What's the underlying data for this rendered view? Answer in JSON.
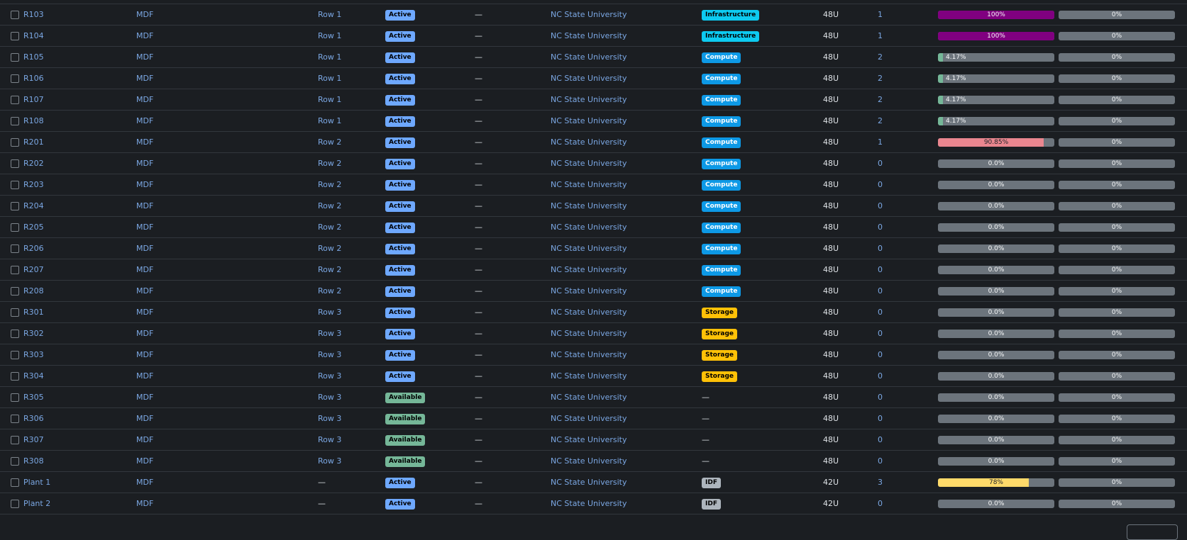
{
  "colors": {
    "active": "#6ea8fe",
    "available": "#75b798",
    "infrastructure": "#0dcaf0",
    "compute": "#0d99e6",
    "storage": "#ffc107",
    "idf": "#adb5bd",
    "util_purple": "#800080",
    "util_green": "#75b798",
    "util_red": "#ea868f",
    "util_yellow": "#ffda6a"
  },
  "racks": [
    {
      "name": "R103",
      "site": "MDF",
      "row": "Row 1",
      "status": "Active",
      "status_kind": "active",
      "tenant_group": "—",
      "tenant": "NC State University",
      "role": "Infrastructure",
      "role_kind": "infrastructure",
      "height": "48U",
      "devices": "1",
      "space": {
        "label": "100%",
        "fraction": 1.0,
        "color": "util_purple"
      },
      "power": "0%"
    },
    {
      "name": "R104",
      "site": "MDF",
      "row": "Row 1",
      "status": "Active",
      "status_kind": "active",
      "tenant_group": "—",
      "tenant": "NC State University",
      "role": "Infrastructure",
      "role_kind": "infrastructure",
      "height": "48U",
      "devices": "1",
      "space": {
        "label": "100%",
        "fraction": 1.0,
        "color": "util_purple"
      },
      "power": "0%"
    },
    {
      "name": "R105",
      "site": "MDF",
      "row": "Row 1",
      "status": "Active",
      "status_kind": "active",
      "tenant_group": "—",
      "tenant": "NC State University",
      "role": "Compute",
      "role_kind": "compute",
      "height": "48U",
      "devices": "2",
      "space": {
        "label": "4.17%",
        "fraction": 0.0417,
        "color": "util_green"
      },
      "power": "0%"
    },
    {
      "name": "R106",
      "site": "MDF",
      "row": "Row 1",
      "status": "Active",
      "status_kind": "active",
      "tenant_group": "—",
      "tenant": "NC State University",
      "role": "Compute",
      "role_kind": "compute",
      "height": "48U",
      "devices": "2",
      "space": {
        "label": "4.17%",
        "fraction": 0.0417,
        "color": "util_green"
      },
      "power": "0%"
    },
    {
      "name": "R107",
      "site": "MDF",
      "row": "Row 1",
      "status": "Active",
      "status_kind": "active",
      "tenant_group": "—",
      "tenant": "NC State University",
      "role": "Compute",
      "role_kind": "compute",
      "height": "48U",
      "devices": "2",
      "space": {
        "label": "4.17%",
        "fraction": 0.0417,
        "color": "util_green"
      },
      "power": "0%"
    },
    {
      "name": "R108",
      "site": "MDF",
      "row": "Row 1",
      "status": "Active",
      "status_kind": "active",
      "tenant_group": "—",
      "tenant": "NC State University",
      "role": "Compute",
      "role_kind": "compute",
      "height": "48U",
      "devices": "2",
      "space": {
        "label": "4.17%",
        "fraction": 0.0417,
        "color": "util_green"
      },
      "power": "0%"
    },
    {
      "name": "R201",
      "site": "MDF",
      "row": "Row 2",
      "status": "Active",
      "status_kind": "active",
      "tenant_group": "—",
      "tenant": "NC State University",
      "role": "Compute",
      "role_kind": "compute",
      "height": "48U",
      "devices": "1",
      "space": {
        "label": "90.85%",
        "fraction": 0.9085,
        "color": "util_red"
      },
      "power": "0%"
    },
    {
      "name": "R202",
      "site": "MDF",
      "row": "Row 2",
      "status": "Active",
      "status_kind": "active",
      "tenant_group": "—",
      "tenant": "NC State University",
      "role": "Compute",
      "role_kind": "compute",
      "height": "48U",
      "devices": "0",
      "space": {
        "label": "0.0%",
        "fraction": 0,
        "color": "util_green"
      },
      "power": "0%"
    },
    {
      "name": "R203",
      "site": "MDF",
      "row": "Row 2",
      "status": "Active",
      "status_kind": "active",
      "tenant_group": "—",
      "tenant": "NC State University",
      "role": "Compute",
      "role_kind": "compute",
      "height": "48U",
      "devices": "0",
      "space": {
        "label": "0.0%",
        "fraction": 0,
        "color": "util_green"
      },
      "power": "0%"
    },
    {
      "name": "R204",
      "site": "MDF",
      "row": "Row 2",
      "status": "Active",
      "status_kind": "active",
      "tenant_group": "—",
      "tenant": "NC State University",
      "role": "Compute",
      "role_kind": "compute",
      "height": "48U",
      "devices": "0",
      "space": {
        "label": "0.0%",
        "fraction": 0,
        "color": "util_green"
      },
      "power": "0%"
    },
    {
      "name": "R205",
      "site": "MDF",
      "row": "Row 2",
      "status": "Active",
      "status_kind": "active",
      "tenant_group": "—",
      "tenant": "NC State University",
      "role": "Compute",
      "role_kind": "compute",
      "height": "48U",
      "devices": "0",
      "space": {
        "label": "0.0%",
        "fraction": 0,
        "color": "util_green"
      },
      "power": "0%"
    },
    {
      "name": "R206",
      "site": "MDF",
      "row": "Row 2",
      "status": "Active",
      "status_kind": "active",
      "tenant_group": "—",
      "tenant": "NC State University",
      "role": "Compute",
      "role_kind": "compute",
      "height": "48U",
      "devices": "0",
      "space": {
        "label": "0.0%",
        "fraction": 0,
        "color": "util_green"
      },
      "power": "0%"
    },
    {
      "name": "R207",
      "site": "MDF",
      "row": "Row 2",
      "status": "Active",
      "status_kind": "active",
      "tenant_group": "—",
      "tenant": "NC State University",
      "role": "Compute",
      "role_kind": "compute",
      "height": "48U",
      "devices": "0",
      "space": {
        "label": "0.0%",
        "fraction": 0,
        "color": "util_green"
      },
      "power": "0%"
    },
    {
      "name": "R208",
      "site": "MDF",
      "row": "Row 2",
      "status": "Active",
      "status_kind": "active",
      "tenant_group": "—",
      "tenant": "NC State University",
      "role": "Compute",
      "role_kind": "compute",
      "height": "48U",
      "devices": "0",
      "space": {
        "label": "0.0%",
        "fraction": 0,
        "color": "util_green"
      },
      "power": "0%"
    },
    {
      "name": "R301",
      "site": "MDF",
      "row": "Row 3",
      "status": "Active",
      "status_kind": "active",
      "tenant_group": "—",
      "tenant": "NC State University",
      "role": "Storage",
      "role_kind": "storage",
      "height": "48U",
      "devices": "0",
      "space": {
        "label": "0.0%",
        "fraction": 0,
        "color": "util_green"
      },
      "power": "0%"
    },
    {
      "name": "R302",
      "site": "MDF",
      "row": "Row 3",
      "status": "Active",
      "status_kind": "active",
      "tenant_group": "—",
      "tenant": "NC State University",
      "role": "Storage",
      "role_kind": "storage",
      "height": "48U",
      "devices": "0",
      "space": {
        "label": "0.0%",
        "fraction": 0,
        "color": "util_green"
      },
      "power": "0%"
    },
    {
      "name": "R303",
      "site": "MDF",
      "row": "Row 3",
      "status": "Active",
      "status_kind": "active",
      "tenant_group": "—",
      "tenant": "NC State University",
      "role": "Storage",
      "role_kind": "storage",
      "height": "48U",
      "devices": "0",
      "space": {
        "label": "0.0%",
        "fraction": 0,
        "color": "util_green"
      },
      "power": "0%"
    },
    {
      "name": "R304",
      "site": "MDF",
      "row": "Row 3",
      "status": "Active",
      "status_kind": "active",
      "tenant_group": "—",
      "tenant": "NC State University",
      "role": "Storage",
      "role_kind": "storage",
      "height": "48U",
      "devices": "0",
      "space": {
        "label": "0.0%",
        "fraction": 0,
        "color": "util_green"
      },
      "power": "0%"
    },
    {
      "name": "R305",
      "site": "MDF",
      "row": "Row 3",
      "status": "Available",
      "status_kind": "available",
      "tenant_group": "—",
      "tenant": "NC State University",
      "role": "—",
      "role_kind": "none",
      "height": "48U",
      "devices": "0",
      "space": {
        "label": "0.0%",
        "fraction": 0,
        "color": "util_green"
      },
      "power": "0%"
    },
    {
      "name": "R306",
      "site": "MDF",
      "row": "Row 3",
      "status": "Available",
      "status_kind": "available",
      "tenant_group": "—",
      "tenant": "NC State University",
      "role": "—",
      "role_kind": "none",
      "height": "48U",
      "devices": "0",
      "space": {
        "label": "0.0%",
        "fraction": 0,
        "color": "util_green"
      },
      "power": "0%"
    },
    {
      "name": "R307",
      "site": "MDF",
      "row": "Row 3",
      "status": "Available",
      "status_kind": "available",
      "tenant_group": "—",
      "tenant": "NC State University",
      "role": "—",
      "role_kind": "none",
      "height": "48U",
      "devices": "0",
      "space": {
        "label": "0.0%",
        "fraction": 0,
        "color": "util_green"
      },
      "power": "0%"
    },
    {
      "name": "R308",
      "site": "MDF",
      "row": "Row 3",
      "status": "Available",
      "status_kind": "available",
      "tenant_group": "—",
      "tenant": "NC State University",
      "role": "—",
      "role_kind": "none",
      "height": "48U",
      "devices": "0",
      "space": {
        "label": "0.0%",
        "fraction": 0,
        "color": "util_green"
      },
      "power": "0%"
    },
    {
      "name": "Plant 1",
      "site": "MDF",
      "row": "—",
      "status": "Active",
      "status_kind": "active",
      "tenant_group": "—",
      "tenant": "NC State University",
      "role": "IDF",
      "role_kind": "idf",
      "height": "42U",
      "devices": "3",
      "space": {
        "label": "78%",
        "fraction": 0.78,
        "color": "util_yellow"
      },
      "power": "0%"
    },
    {
      "name": "Plant 2",
      "site": "MDF",
      "row": "—",
      "status": "Active",
      "status_kind": "active",
      "tenant_group": "—",
      "tenant": "NC State University",
      "role": "IDF",
      "role_kind": "idf",
      "height": "42U",
      "devices": "0",
      "space": {
        "label": "0.0%",
        "fraction": 0,
        "color": "util_green"
      },
      "power": "0%"
    }
  ]
}
